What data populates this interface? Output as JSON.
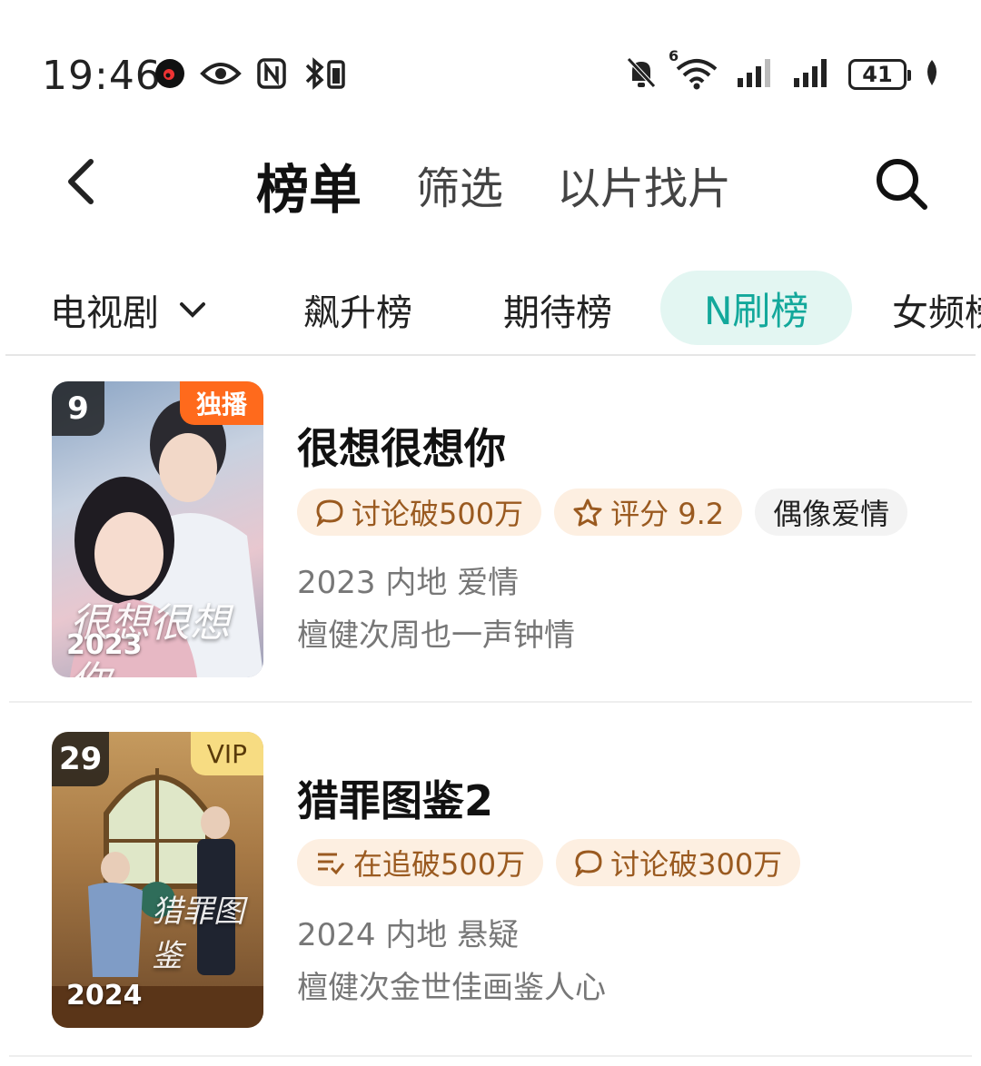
{
  "status_bar": {
    "time": "19:46",
    "battery_level": "41",
    "cellular_label": "6"
  },
  "header": {
    "tabs": [
      {
        "label": "榜单",
        "active": true
      },
      {
        "label": "筛选",
        "active": false
      },
      {
        "label": "以片找片",
        "active": false
      }
    ]
  },
  "categories": {
    "dropdown_label": "电视剧",
    "items": [
      {
        "label": "飙升榜",
        "active": false
      },
      {
        "label": "期待榜",
        "active": false
      },
      {
        "label": "N刷榜",
        "active": true
      },
      {
        "label": "女频榜",
        "active": false
      }
    ],
    "accent_color": "#13a89b"
  },
  "items": [
    {
      "rank": "9",
      "badge": "独播",
      "year_overlay": "2023",
      "poster_script": "很想很想你",
      "title": "很想很想你",
      "tags": [
        {
          "icon": "chat-bubble-icon",
          "text": "讨论破500万",
          "style": "orange"
        },
        {
          "icon": "star-icon",
          "text": "评分 9.2",
          "style": "orange"
        },
        {
          "icon": "",
          "text": "偶像爱情",
          "style": "gray"
        }
      ],
      "meta": "2023 内地 爱情",
      "description": "檀健次周也一声钟情"
    },
    {
      "rank": "29",
      "badge": "VIP",
      "year_overlay": "2024",
      "poster_script": "猎罪图鉴",
      "title": "猎罪图鉴2",
      "tags": [
        {
          "icon": "follow-list-icon",
          "text": "在追破500万",
          "style": "orange"
        },
        {
          "icon": "chat-bubble-icon",
          "text": "讨论破300万",
          "style": "orange"
        }
      ],
      "meta": "2024 内地 悬疑",
      "description": "檀健次金世佳画鉴人心"
    }
  ]
}
